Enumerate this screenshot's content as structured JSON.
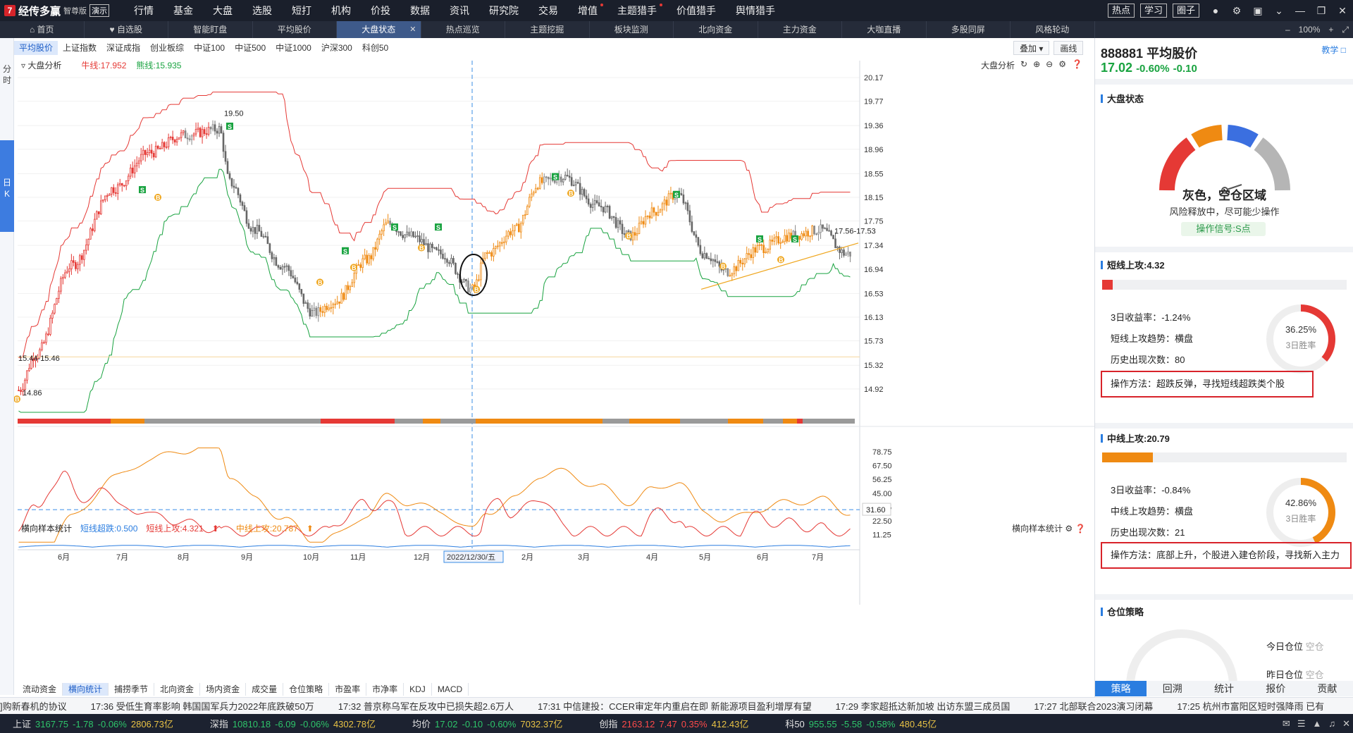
{
  "app": {
    "name": "经传多赢",
    "version": "智尊版",
    "demo": "演示"
  },
  "topmenu": [
    {
      "label": "行情",
      "dot": false
    },
    {
      "label": "基金",
      "dot": false
    },
    {
      "label": "大盘",
      "dot": false
    },
    {
      "label": "选股",
      "dot": false
    },
    {
      "label": "短打",
      "dot": false
    },
    {
      "label": "机构",
      "dot": false
    },
    {
      "label": "价投",
      "dot": false
    },
    {
      "label": "数据",
      "dot": false
    },
    {
      "label": "资讯",
      "dot": false
    },
    {
      "label": "研究院",
      "dot": false
    },
    {
      "label": "交易",
      "dot": false
    },
    {
      "label": "增值",
      "dot": true
    },
    {
      "label": "主题猎手",
      "dot": true
    },
    {
      "label": "价值猎手",
      "dot": false
    },
    {
      "label": "舆情猎手",
      "dot": false
    }
  ],
  "topright": {
    "hot": "热点",
    "learn": "学习",
    "circle": "圈子",
    "icons": [
      "user-icon",
      "gear-icon",
      "window-icon",
      "minimize-dropdown-icon",
      "minimize-icon",
      "restore-icon",
      "close-icon"
    ]
  },
  "tabs": [
    {
      "label": "首页",
      "icon": "home",
      "active": false
    },
    {
      "label": "自选股",
      "icon": "heart",
      "active": false
    },
    {
      "label": "智能盯盘",
      "icon": "",
      "active": false
    },
    {
      "label": "平均股价",
      "icon": "",
      "active": false
    },
    {
      "label": "大盘状态",
      "icon": "",
      "active": true
    },
    {
      "label": "热点巡览",
      "icon": "",
      "active": false
    },
    {
      "label": "主题挖掘",
      "icon": "",
      "active": false
    },
    {
      "label": "板块监测",
      "icon": "",
      "active": false
    },
    {
      "label": "北向资金",
      "icon": "",
      "active": false
    },
    {
      "label": "主力资金",
      "icon": "",
      "active": false
    },
    {
      "label": "大咖直播",
      "icon": "",
      "active": false
    },
    {
      "label": "多股同屏",
      "icon": "",
      "active": false
    },
    {
      "label": "风格轮动",
      "icon": "",
      "active": false
    }
  ],
  "tabbar_right": {
    "zoom": "100%"
  },
  "left_strip": {
    "fen": "分",
    "shi": "时",
    "ri": "日",
    "k": "K"
  },
  "index_tabs": [
    {
      "label": "平均股价",
      "active": true
    },
    {
      "label": "上证指数",
      "active": false
    },
    {
      "label": "深证成指",
      "active": false
    },
    {
      "label": "创业板综",
      "active": false
    },
    {
      "label": "中证100",
      "active": false
    },
    {
      "label": "中证500",
      "active": false
    },
    {
      "label": "中证1000",
      "active": false
    },
    {
      "label": "沪深300",
      "active": false
    },
    {
      "label": "科创50",
      "active": false
    }
  ],
  "index_tabs_right": {
    "overlay": "叠加 ▾",
    "draw": "画线"
  },
  "chart_header": {
    "title": "大盘分析",
    "bull_line": "牛线:17.952",
    "bear_line": "熊线:15.935"
  },
  "chart_tools": {
    "label": "大盘分析"
  },
  "chart_data": [
    {
      "type": "candlestick",
      "title": "大盘分析",
      "yticks": [
        20.17,
        19.77,
        19.36,
        18.96,
        18.55,
        18.15,
        17.75,
        17.34,
        16.94,
        16.53,
        16.13,
        15.73,
        15.32,
        14.92
      ],
      "ylim": [
        14.55,
        20.17
      ],
      "x_labels": [
        "6月",
        "7月",
        "8月",
        "9月",
        "10月",
        "11月",
        "12月",
        "2022/12/30/五",
        "2月",
        "3月",
        "4月",
        "5月",
        "6月",
        "7月"
      ],
      "annotations": [
        "19.50",
        "15.44-15.46",
        "14.86",
        "17.56-17.53"
      ],
      "markers": {
        "S": "S",
        "B": "B"
      },
      "series": [
        {
          "name": "牛线",
          "color": "#e53935"
        },
        {
          "name": "熊线",
          "color": "#19a340"
        }
      ]
    },
    {
      "type": "line",
      "title": "横向样本统计",
      "yticks": [
        78.75,
        67.5,
        56.25,
        45.0,
        33.75,
        22.5,
        11.25
      ],
      "ylim": [
        0,
        84
      ],
      "highlight_value": 31.6,
      "series": [
        {
          "name": "短线超跌",
          "value": 0.5,
          "color": "#2a7de0"
        },
        {
          "name": "短线上攻",
          "value": 4.321,
          "color": "#e53935"
        },
        {
          "name": "中线上攻",
          "value": 20.787,
          "color": "#ef8a12"
        }
      ]
    }
  ],
  "indicator_header": {
    "title": "横向样本统计",
    "short_drop": "短线超跌:0.500",
    "short_up": "短线上攻:4.321",
    "mid_up": "中线上攻:20.787",
    "arrow": "⬆"
  },
  "indicator_tools": {
    "label": "横向样本统计"
  },
  "bottom_tabs": [
    {
      "label": "流动资金",
      "active": false
    },
    {
      "label": "横向统计",
      "active": true
    },
    {
      "label": "捕捞季节",
      "active": false
    },
    {
      "label": "北向资金",
      "active": false
    },
    {
      "label": "场内资金",
      "active": false
    },
    {
      "label": "成交量",
      "active": false
    },
    {
      "label": "仓位策略",
      "active": false
    },
    {
      "label": "市盈率",
      "active": false
    },
    {
      "label": "市净率",
      "active": false
    },
    {
      "label": "KDJ",
      "active": false
    },
    {
      "label": "MACD",
      "active": false
    }
  ],
  "ticker": [
    "]购新春机的协议",
    "17:36 受低生育率影响 韩国国军兵力2022年底跌破50万",
    "17:32 普京称乌军在反攻中已损失超2.6万人",
    "17:31 中信建投：CCER审定年内重启在即 新能源项目盈利增厚有望",
    "17:29 李家超抵达新加坡 出访东盟三成员国",
    "17:27 北部联合2023演习闭幕",
    "17:25 杭州市富阳区短时强降雨 已有"
  ],
  "status": [
    {
      "label": "上证",
      "value": "3167.75",
      "chg": "-1.78",
      "pct": "-0.06%",
      "amount": "2806.73亿",
      "dir": "dn"
    },
    {
      "label": "深指",
      "value": "10810.18",
      "chg": "-6.09",
      "pct": "-0.06%",
      "amount": "4302.78亿",
      "dir": "dn"
    },
    {
      "label": "均价",
      "value": "17.02",
      "chg": "-0.10",
      "pct": "-0.60%",
      "amount": "7032.37亿",
      "dir": "dn"
    },
    {
      "label": "创指",
      "value": "2163.12",
      "chg": "7.47",
      "pct": "0.35%",
      "amount": "412.43亿",
      "dir": "up"
    },
    {
      "label": "科50",
      "value": "955.55",
      "chg": "-5.58",
      "pct": "-0.58%",
      "amount": "480.45亿",
      "dir": "dn"
    }
  ],
  "right_panel": {
    "code_name": "888881 平均股价",
    "teach": "教学",
    "price": "17.02",
    "change": "-0.60%",
    "change_amt": "-0.10",
    "market_state": {
      "title": "大盘状态",
      "state": "灰色，空仓区域",
      "desc": "风险释放中，尽可能少操作",
      "signal": "操作信号:S点"
    },
    "short_attack": {
      "title": "短线上攻:4.32",
      "level": 0.0432,
      "return_3d": "3日收益率：-1.24%",
      "trend": "短线上攻趋势：横盘",
      "count": "历史出现次数：80",
      "win_rate": "36.25%",
      "win_rate_value": 36.25,
      "win_label": "3日胜率",
      "method": "操作方法：超跌反弹，寻找短线超跌类个股"
    },
    "mid_attack": {
      "title": "中线上攻:20.79",
      "level": 0.2079,
      "return_3d": "3日收益率：-0.84%",
      "trend": "中线上攻趋势：横盘",
      "count": "历史出现次数：21",
      "win_rate": "42.86%",
      "win_rate_value": 42.86,
      "win_label": "3日胜率",
      "method": "操作方法：底部上升，个股进入建仓阶段，寻找新入主力"
    },
    "position": {
      "title": "仓位策略",
      "today": "今日仓位",
      "today_val": "空仓",
      "yesterday": "昨日仓位",
      "yesterday_val": "空仓"
    }
  },
  "right_tabs": [
    {
      "label": "策略",
      "active": true
    },
    {
      "label": "回溯",
      "active": false
    },
    {
      "label": "统计",
      "active": false
    },
    {
      "label": "报价",
      "active": false
    },
    {
      "label": "贡献",
      "active": false
    }
  ],
  "colors": {
    "up": "#e53935",
    "down": "#19a340",
    "orange": "#ef8a12",
    "blue": "#2a7de0",
    "gray": "#9a9a9a"
  }
}
